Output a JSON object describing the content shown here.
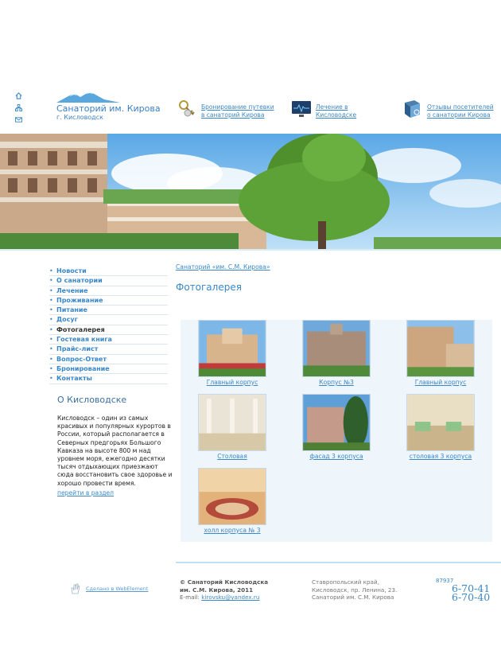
{
  "header": {
    "logo_name": "Санаторий им. Кирова",
    "logo_city": "г. Кисловодск",
    "links": [
      {
        "line1": "Бронирование путевки",
        "line2": "в санаторий Кирова",
        "icon": "keys-icon"
      },
      {
        "line1": "Лечение в",
        "line2": "Кисловодске",
        "icon": "monitor-icon"
      },
      {
        "line1": "Отзывы посетителей",
        "line2": "о санатории Кирова",
        "icon": "book-icon"
      }
    ]
  },
  "menu": [
    "Новости",
    "О санатории",
    "Лечение",
    "Проживание",
    "Питание",
    "Досуг",
    "Фотогалерея",
    "Гостевая книга",
    "Прайс-лист",
    "Вопрос-Ответ",
    "Бронирование",
    "Контакты"
  ],
  "about": {
    "title": "О Кисловодске",
    "text": "Кисловодск – один из самых красивых и популярных курортов в России, который располагается в Северных предгорьях Большого Кавказа на высоте 800 м над уровнем моря, ежегодно десятки тысяч отдыхающих приезжают сюда восстановить свое здоровье и хорошо провести время.",
    "link": "перейти в раздел"
  },
  "content": {
    "breadcrumb": "Санаторий «им. С.М. Кирова»",
    "title": "Фотогалерея",
    "gallery": [
      "Главный корпус",
      "Корпус №3",
      "Главный корпус",
      "Столовая",
      "фасад 3 корпуса",
      "столовая 3 корпуса",
      "холл корпуса № 3"
    ]
  },
  "footer": {
    "webelement": "Сделано в WebElement",
    "copyright_line1": "© Санаторий Кисловодска",
    "copyright_line2": "им. С.М. Кирова, 2011",
    "email_label": "E-mail:",
    "email": "kirovsku@yandex.ru",
    "address_line1": "Ставропольский край,",
    "address_line2": "Кисловодск, пр. Ленина, 23.",
    "address_line3": "Санаторий им. С.М. Кирова",
    "phone_code": "87937",
    "phone1": "6-70-41",
    "phone2": "6-70-40"
  },
  "colors": {
    "accent": "#3a87c8",
    "sky": "#8cc4ec"
  }
}
